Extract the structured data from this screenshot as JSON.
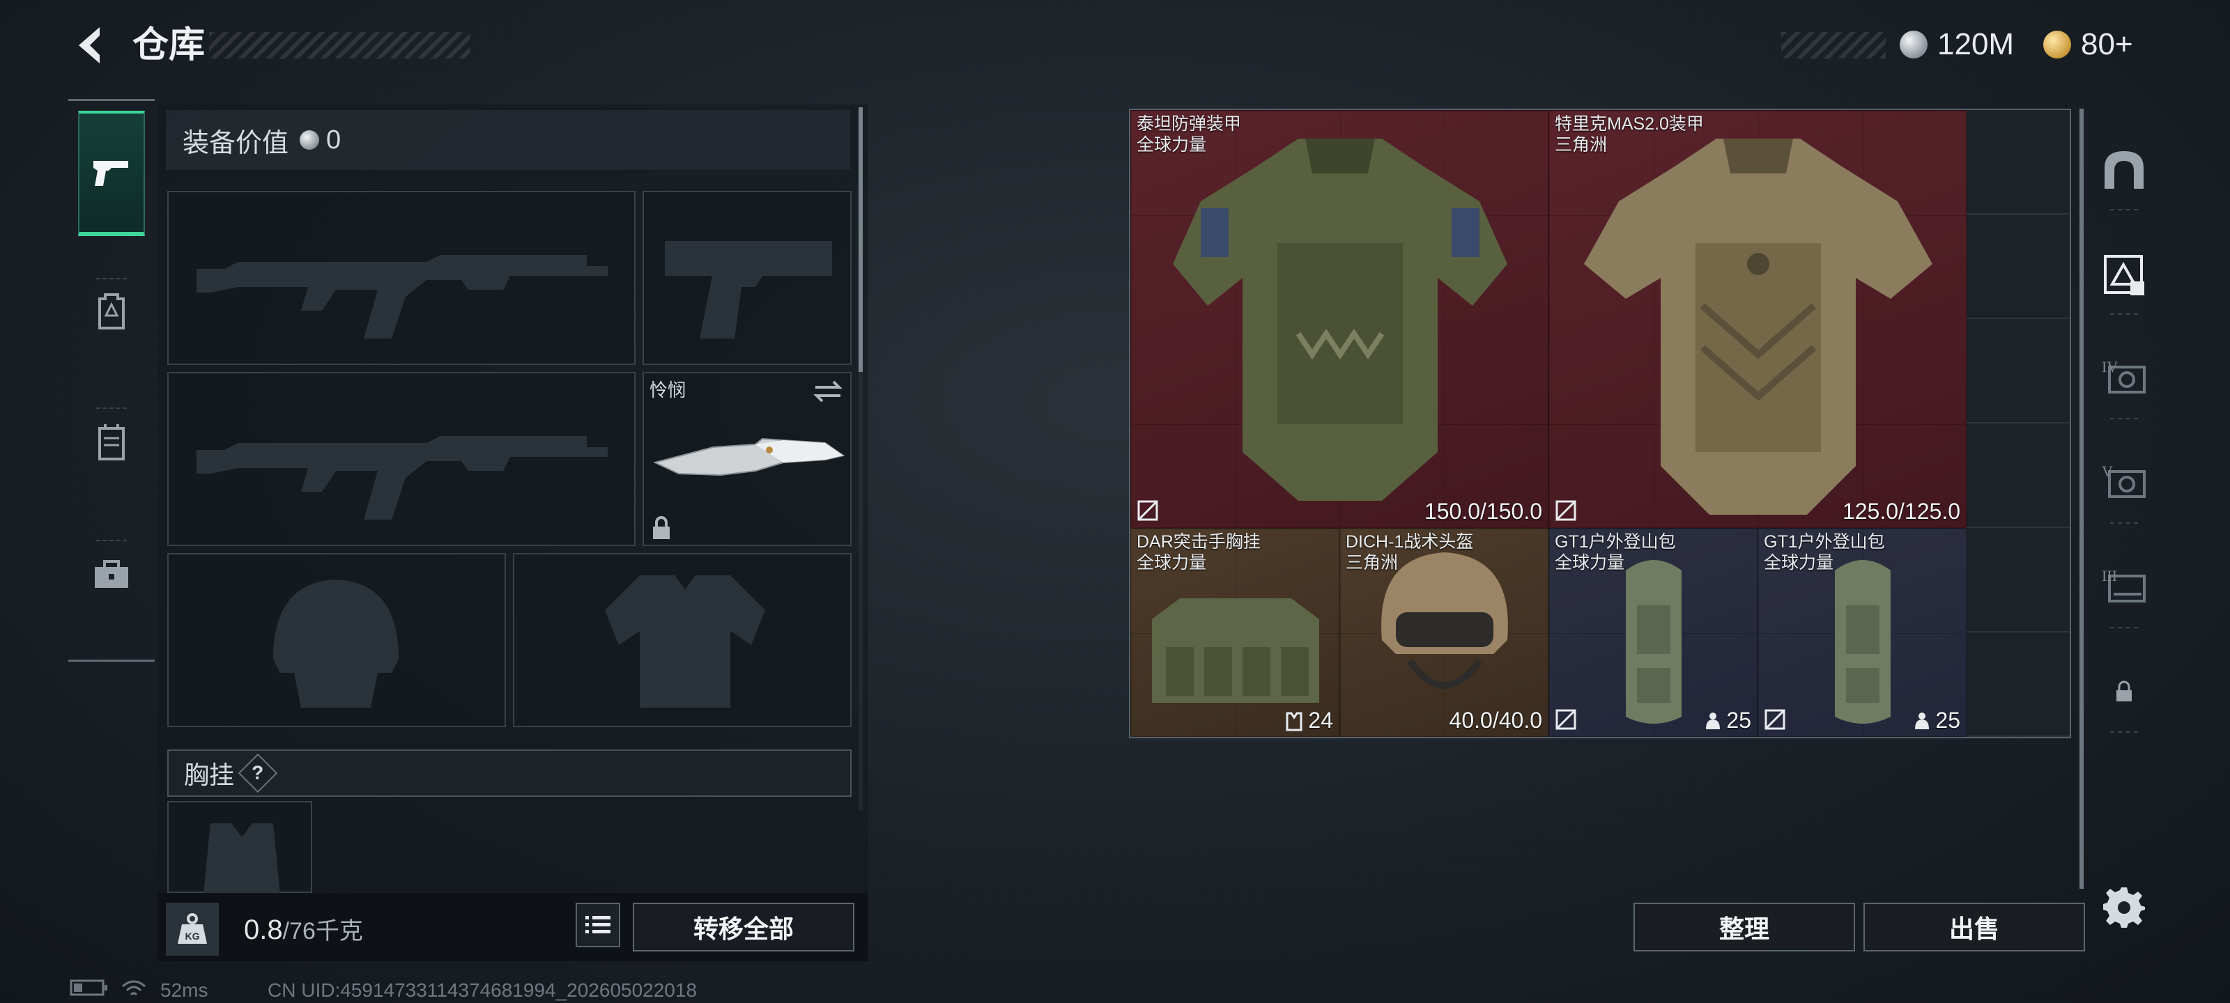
{
  "header": {
    "title": "仓库"
  },
  "currency": {
    "silver": "120M",
    "gold": "80+"
  },
  "left_tabs": [
    {
      "icon": "pistol-icon",
      "active": true
    },
    {
      "icon": "backpack-icon",
      "active": false
    },
    {
      "icon": "chest-rig-icon",
      "active": false
    },
    {
      "icon": "briefcase-icon",
      "active": false
    }
  ],
  "equipment": {
    "value_label": "装备价值",
    "value": "0",
    "melee_name": "怜悯",
    "chest_title": "胸挂",
    "help_mark": "?"
  },
  "weight": {
    "current": "0.8",
    "max": "/76千克"
  },
  "buttons": {
    "transfer_all": "转移全部",
    "sort": "整理",
    "sell": "出售"
  },
  "stash_items": [
    {
      "name": "泰坦防弹装甲",
      "sub": "全球力量",
      "stat": "150.0/150.0",
      "rarity": "red"
    },
    {
      "name": "特里克MAS2.0装甲",
      "sub": "三角洲",
      "stat": "125.0/125.0",
      "rarity": "red"
    },
    {
      "name": "DAR突击手胸挂",
      "sub": "全球力量",
      "stat": "24",
      "rarity": "brown"
    },
    {
      "name": "DICH-1战术头盔",
      "sub": "三角洲",
      "stat": "40.0/40.0",
      "rarity": "brown"
    },
    {
      "name": "GT1户外登山包",
      "sub": "全球力量",
      "stat": "25",
      "rarity": "blue"
    },
    {
      "name": "GT1户外登山包",
      "sub": "全球力量",
      "stat": "25",
      "rarity": "blue"
    }
  ],
  "side_tabs": [
    {
      "icon": "armor-vault-icon",
      "tag": ""
    },
    {
      "icon": "warning-box-icon",
      "tag": ""
    },
    {
      "icon": "stash-tier-icon",
      "tag": "IV"
    },
    {
      "icon": "stash-tier-icon",
      "tag": "V"
    },
    {
      "icon": "stash-tier-icon",
      "tag": "III"
    },
    {
      "icon": "lock-icon",
      "tag": ""
    }
  ],
  "status": {
    "ping": "52ms",
    "uid": "CN UID:459147331143746819​94_202605022018"
  },
  "colors": {
    "accent": "#3fd49b",
    "red_rarity": "#4f1f27",
    "brown_rarity": "#4a3a2a",
    "blue_rarity": "#2a2d3f"
  }
}
